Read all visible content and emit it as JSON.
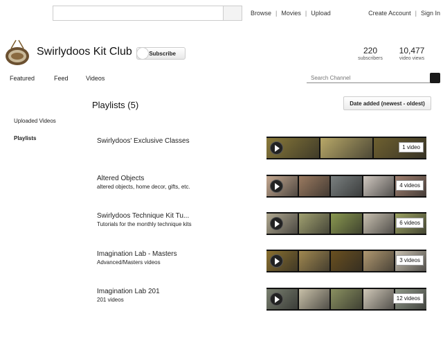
{
  "topbar": {
    "nav_left": [
      "Browse",
      "Movies",
      "Upload"
    ],
    "nav_right": [
      "Create Account",
      "Sign In"
    ]
  },
  "channel": {
    "title": "Swirlydoos Kit Club",
    "subscribe_label": "Subscribe",
    "subscribers": "220",
    "subscribers_label": "subscribers",
    "views": "10,477",
    "views_label": "video views"
  },
  "channel_nav": {
    "featured": "Featured",
    "feed": "Feed",
    "videos": "Videos",
    "search_placeholder": "Search Channel"
  },
  "section": {
    "title": "Playlists (5)",
    "sort_label": "Date added (newest - oldest)"
  },
  "sidebar": {
    "uploaded": "Uploaded Videos",
    "playlists": "Playlists"
  },
  "playlists": [
    {
      "title": "Swirlydoos' Exclusive Classes",
      "desc": "",
      "count": "1 video",
      "colors": [
        "#8a7a3a",
        "#b8a868",
        "#6e6030"
      ]
    },
    {
      "title": "Altered Objects",
      "desc": "altered objects, home decor, gifts, etc.",
      "count": "4 videos",
      "colors": [
        "#c4a890",
        "#9a7a60",
        "#7a8080",
        "#d0c8c0",
        "#a08070"
      ]
    },
    {
      "title": "Swirlydoos Technique Kit Tu...",
      "desc": "Tutorials for the monthly technique kits",
      "count": "6 videos",
      "colors": [
        "#b0a890",
        "#a0a070",
        "#8a9850",
        "#c8c0b0",
        "#9aa060"
      ]
    },
    {
      "title": "Imagination Lab - Masters",
      "desc": "Advanced/Masters videos",
      "count": "3 videos",
      "colors": [
        "#8a7030",
        "#a08850",
        "#6a5020",
        "#b09870",
        "#c8c0b0"
      ]
    },
    {
      "title": "Imagination Lab 201",
      "desc": "201 videos",
      "count": "12 videos",
      "colors": [
        "#7a8070",
        "#c8c0a8",
        "#8a9060",
        "#d0c8b8",
        "#909888"
      ]
    }
  ]
}
